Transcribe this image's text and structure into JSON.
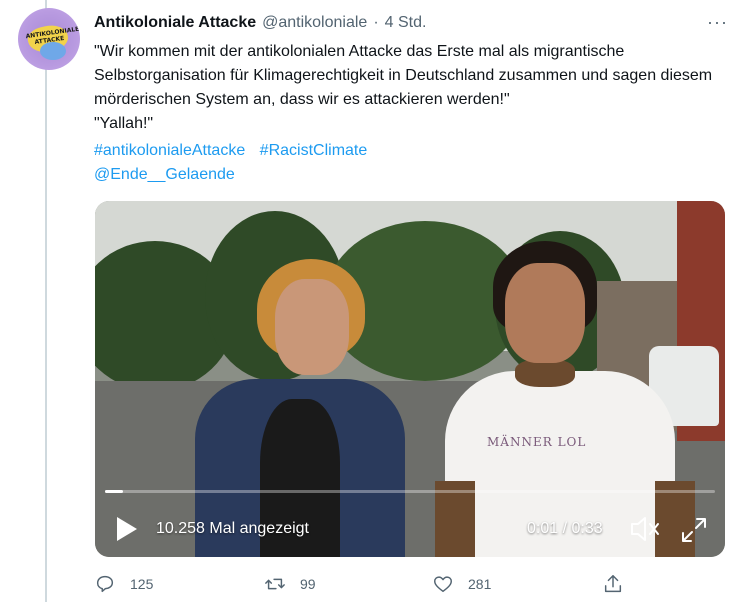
{
  "tweet": {
    "author_name": "Antikoloniale Attacke",
    "handle": "@antikoloniale",
    "separator": "·",
    "time": "4 Std.",
    "avatar_text": "ANTIKOLONIALE ATTACKE",
    "more_label": "···",
    "text_line1": "\"Wir kommen mit der antikolonialen Attacke das Erste mal als migrantische Selbstorganisation für Klimagerechtigkeit in Deutschland zusammen und sagen diesem mörderischen System an, dass wir es attackieren werden!\"",
    "text_line2": "\"Yallah!\"",
    "hashtags": [
      "#antikolonialeAttacke",
      "#RacistClimate"
    ],
    "mention": "@Ende__Gelaende"
  },
  "video": {
    "shirt_print": "MÄNNER LOL",
    "views": "10.258 Mal angezeigt",
    "time": "0:01 / 0:33",
    "progress": 0.03
  },
  "actions": {
    "reply_count": "125",
    "retweet_count": "99",
    "like_count": "281"
  },
  "icons": [
    "play-icon",
    "mute-icon",
    "fullscreen-icon",
    "reply-icon",
    "retweet-icon",
    "like-icon",
    "share-icon"
  ],
  "colors": {
    "link": "#1d9bf0",
    "secondary": "#536471",
    "text": "#0f1419"
  }
}
